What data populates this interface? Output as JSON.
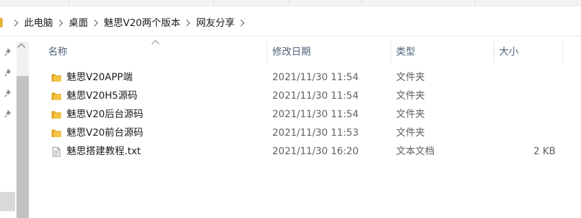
{
  "breadcrumb": {
    "items": [
      "此电脑",
      "桌面",
      "魅思V20两个版本",
      "网友分享"
    ]
  },
  "columns": {
    "name": "名称",
    "date": "修改日期",
    "type": "类型",
    "size": "大小"
  },
  "files": [
    {
      "icon": "folder-icon",
      "name": "魅思V20APP端",
      "date": "2021/11/30 11:54",
      "type": "文件夹",
      "size": ""
    },
    {
      "icon": "folder-icon",
      "name": "魅思V20H5源码",
      "date": "2021/11/30 11:54",
      "type": "文件夹",
      "size": ""
    },
    {
      "icon": "folder-icon",
      "name": "魅思V20后台源码",
      "date": "2021/11/30 11:54",
      "type": "文件夹",
      "size": ""
    },
    {
      "icon": "folder-icon",
      "name": "魅思V20前台源码",
      "date": "2021/11/30 11:53",
      "type": "文件夹",
      "size": ""
    },
    {
      "icon": "text-file-icon",
      "name": "魅思搭建教程.txt",
      "date": "2021/11/30 16:20",
      "type": "文本文档",
      "size": "2 KB"
    }
  ],
  "colors": {
    "folder": "#f5c342",
    "folder_dark": "#e3a92a",
    "header_text": "#4c607a"
  }
}
